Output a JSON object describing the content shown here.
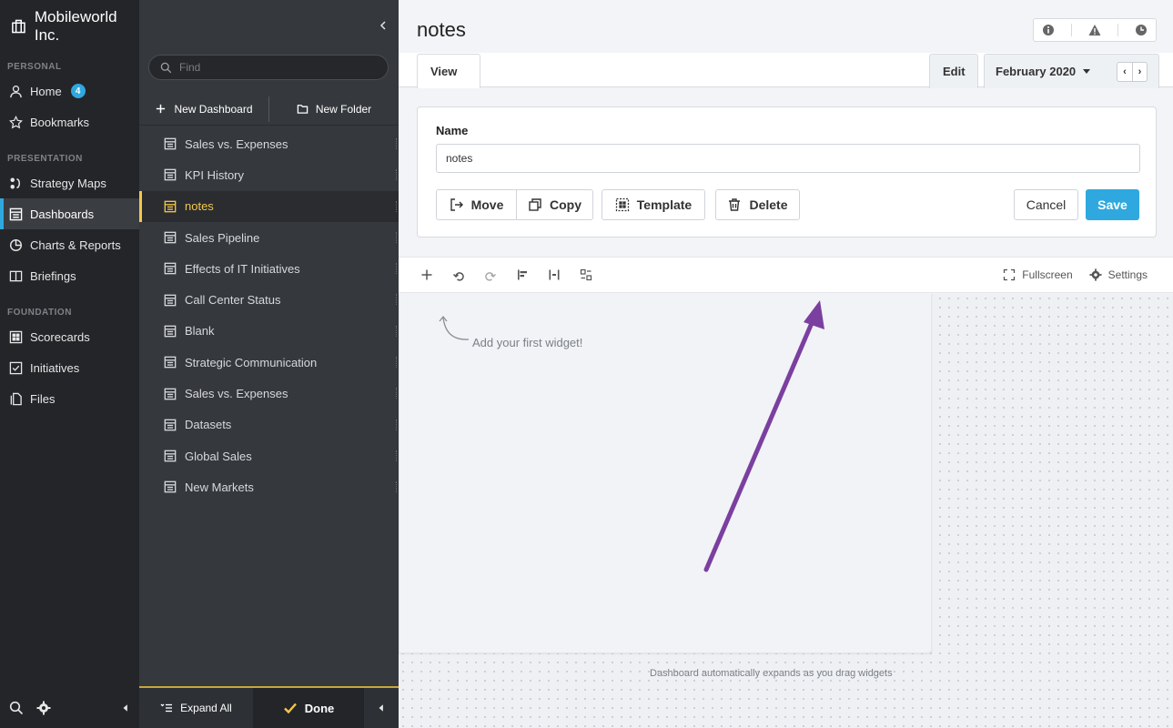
{
  "sidebar": {
    "org_name": "Mobileworld Inc.",
    "sections": {
      "personal": "PERSONAL",
      "presentation": "PRESENTATION",
      "foundation": "FOUNDATION"
    },
    "items": [
      {
        "label": "Home",
        "badge": "4",
        "icon": "user-icon"
      },
      {
        "label": "Bookmarks",
        "icon": "star-icon"
      },
      {
        "label": "Strategy Maps",
        "icon": "strategy-map-icon"
      },
      {
        "label": "Dashboards",
        "icon": "dashboard-icon",
        "active": true
      },
      {
        "label": "Charts & Reports",
        "icon": "pie-chart-icon"
      },
      {
        "label": "Briefings",
        "icon": "book-icon"
      },
      {
        "label": "Scorecards",
        "icon": "scorecard-icon"
      },
      {
        "label": "Initiatives",
        "icon": "checkbox-icon"
      },
      {
        "label": "Files",
        "icon": "files-icon"
      }
    ]
  },
  "panel": {
    "search_placeholder": "Find",
    "new_dashboard": "New Dashboard",
    "new_folder": "New Folder",
    "items": [
      "Sales vs. Expenses",
      "KPI History",
      "notes",
      "Sales Pipeline",
      "Effects of IT Initiatives",
      "Call Center Status",
      "Blank",
      "Strategic Communication",
      "Sales vs. Expenses",
      "Datasets",
      "Global Sales",
      "New Markets"
    ],
    "active_index": 2,
    "expand_all": "Expand All",
    "done": "Done"
  },
  "main": {
    "title": "notes",
    "tabs": {
      "view": "View",
      "edit": "Edit",
      "period": "February 2020"
    },
    "form": {
      "name_label": "Name",
      "name_value": "notes",
      "move": "Move",
      "copy": "Copy",
      "template": "Template",
      "delete": "Delete",
      "cancel": "Cancel",
      "save": "Save"
    },
    "toolbar": {
      "fullscreen": "Fullscreen",
      "settings": "Settings"
    },
    "canvas": {
      "hint": "Add your first widget!",
      "expand_note": "Dashboard automatically expands as you drag widgets"
    }
  },
  "colors": {
    "accent": "#2fa8df",
    "active_item": "#f3c84b",
    "annotation_arrow": "#7b3fa0"
  }
}
